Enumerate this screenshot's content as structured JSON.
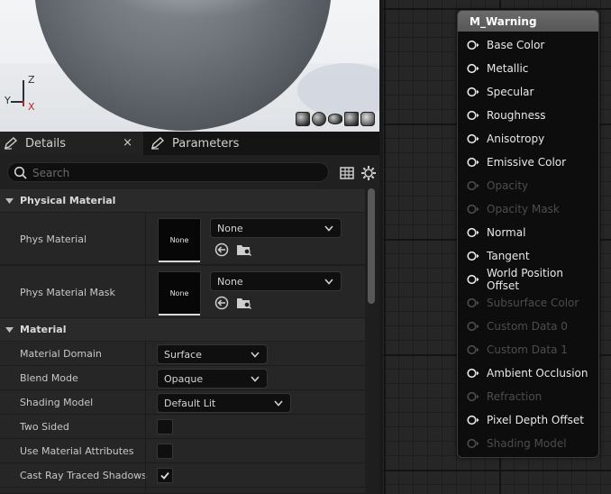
{
  "viewport": {
    "axis_z": "Z",
    "axis_y": "Y",
    "axis_x": "X",
    "preview_shapes": [
      "cylinder-icon",
      "sphere-icon",
      "plane-icon",
      "cube-icon",
      "teapot-icon"
    ]
  },
  "tabs": [
    {
      "label": "Details",
      "icon": "pencil-icon",
      "active": true
    },
    {
      "label": "Parameters",
      "icon": "pencil-icon",
      "active": false
    }
  ],
  "details_close": "×",
  "search": {
    "placeholder": "Search"
  },
  "sections": {
    "physical_material": {
      "title": "Physical Material",
      "rows": [
        {
          "label": "Phys Material",
          "thumb": "None",
          "value": "None"
        },
        {
          "label": "Phys Material Mask",
          "thumb": "None",
          "value": "None"
        }
      ]
    },
    "material": {
      "title": "Material",
      "rows": [
        {
          "label": "Material Domain",
          "value": "Surface"
        },
        {
          "label": "Blend Mode",
          "value": "Opaque"
        },
        {
          "label": "Shading Model",
          "value": "Default Lit"
        },
        {
          "label": "Two Sided",
          "checked": false
        },
        {
          "label": "Use Material Attributes",
          "checked": false
        },
        {
          "label": "Cast Ray Traced Shadows",
          "checked": true
        }
      ]
    }
  },
  "node": {
    "title": "M_Warning",
    "pins": [
      {
        "label": "Base Color",
        "enabled": true
      },
      {
        "label": "Metallic",
        "enabled": true
      },
      {
        "label": "Specular",
        "enabled": true
      },
      {
        "label": "Roughness",
        "enabled": true
      },
      {
        "label": "Anisotropy",
        "enabled": true
      },
      {
        "label": "Emissive Color",
        "enabled": true
      },
      {
        "label": "Opacity",
        "enabled": false
      },
      {
        "label": "Opacity Mask",
        "enabled": false
      },
      {
        "label": "Normal",
        "enabled": true
      },
      {
        "label": "Tangent",
        "enabled": true
      },
      {
        "label": "World Position Offset",
        "enabled": true
      },
      {
        "label": "Subsurface Color",
        "enabled": false
      },
      {
        "label": "Custom Data 0",
        "enabled": false
      },
      {
        "label": "Custom Data 1",
        "enabled": false
      },
      {
        "label": "Ambient Occlusion",
        "enabled": true
      },
      {
        "label": "Refraction",
        "enabled": false
      },
      {
        "label": "Pixel Depth Offset",
        "enabled": true
      },
      {
        "label": "Shading Model",
        "enabled": false
      }
    ]
  },
  "colors": {
    "pin_enabled": "#e8e8e8",
    "pin_disabled": "#4d4d4d",
    "axis_x": "#c0252a",
    "node_title": "#5f5f5f"
  }
}
